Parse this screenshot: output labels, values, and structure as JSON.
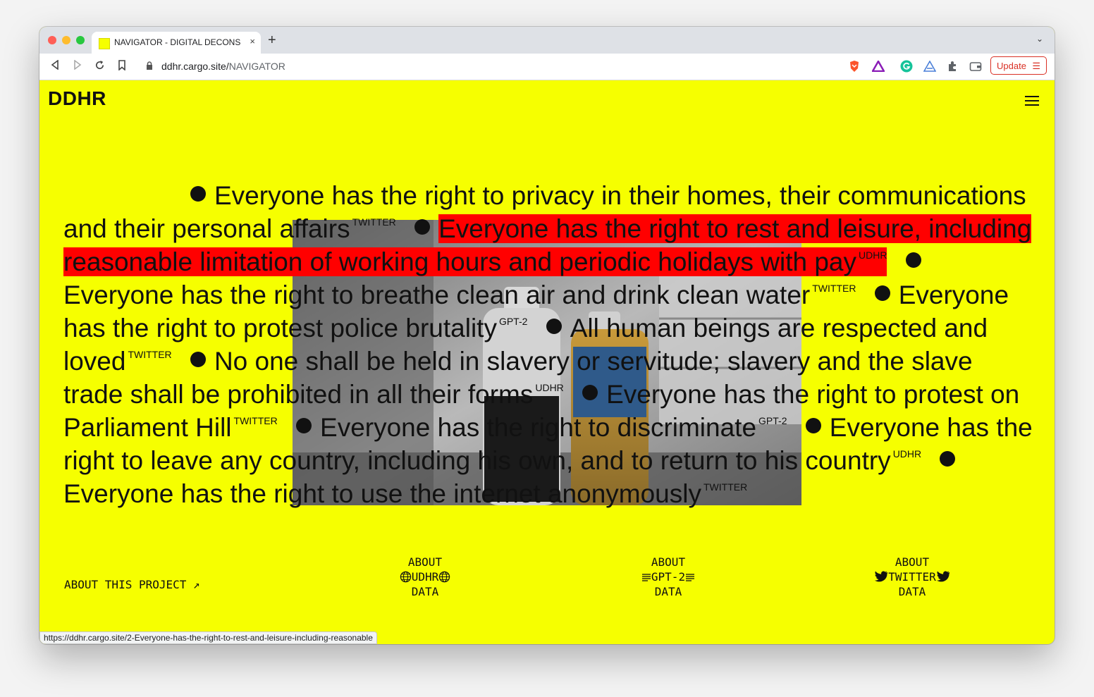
{
  "browser": {
    "tab_title": "NAVIGATOR - DIGITAL DECONS",
    "close_glyph": "×",
    "new_tab_glyph": "+",
    "overflow_glyph": "⌄",
    "url_host": "ddhr.cargo.site/",
    "url_path": "NAVIGATOR",
    "update_label": "Update",
    "update_menu_glyph": "☰"
  },
  "page": {
    "logo": "DDHR",
    "sentences": [
      {
        "text": "Everyone has the right to privacy in their homes, their communications and their personal affairs",
        "tag": "TWITTER",
        "highlighted": false
      },
      {
        "text": "Everyone has the right to rest and leisure, including reasonable limitation of working hours and periodic holidays with pay",
        "tag": "UDHR",
        "highlighted": true
      },
      {
        "text": "Everyone has the right to breathe clean air and drink clean water",
        "tag": "TWITTER",
        "highlighted": false
      },
      {
        "text": "Everyone has the right to protest police brutality",
        "tag": "GPT-2",
        "highlighted": false
      },
      {
        "text": "All human beings are respected and loved",
        "tag": "TWITTER",
        "highlighted": false
      },
      {
        "text": "No one shall be held in slavery or servitude; slavery and the slave trade shall be prohibited in all their forms",
        "tag": "UDHR",
        "highlighted": false
      },
      {
        "text": "Everyone has the right to protest on Parliament Hill",
        "tag": "TWITTER",
        "highlighted": false
      },
      {
        "text": "Everyone has the right to discriminate",
        "tag": "GPT-2",
        "highlighted": false
      },
      {
        "text": "Everyone has the right to leave any country, including his own, and to return to his country",
        "tag": "UDHR",
        "highlighted": false
      },
      {
        "text": "Everyone has the right to use the internet anonymously",
        "tag": "TWITTER",
        "highlighted": false
      }
    ],
    "footer": {
      "about_project": "ABOUT THIS PROJECT",
      "about_project_arrow": "↗",
      "udhr": {
        "line1": "ABOUT",
        "line2": "UDHR",
        "line3": "DATA",
        "icon": "globe-icon"
      },
      "gpt2": {
        "line1": "ABOUT",
        "line2": "GPT-2",
        "line3": "DATA",
        "icon": "text-lines-icon"
      },
      "twitter": {
        "line1": "ABOUT",
        "line2": "TWITTER",
        "line3": "DATA",
        "icon": "twitter-bird-icon"
      }
    },
    "status_url": "https://ddhr.cargo.site/2-Everyone-has-the-right-to-rest-and-leisure-including-reasonable"
  },
  "colors": {
    "background": "#f6ff00",
    "highlight": "#ff0000",
    "text": "#111111"
  }
}
